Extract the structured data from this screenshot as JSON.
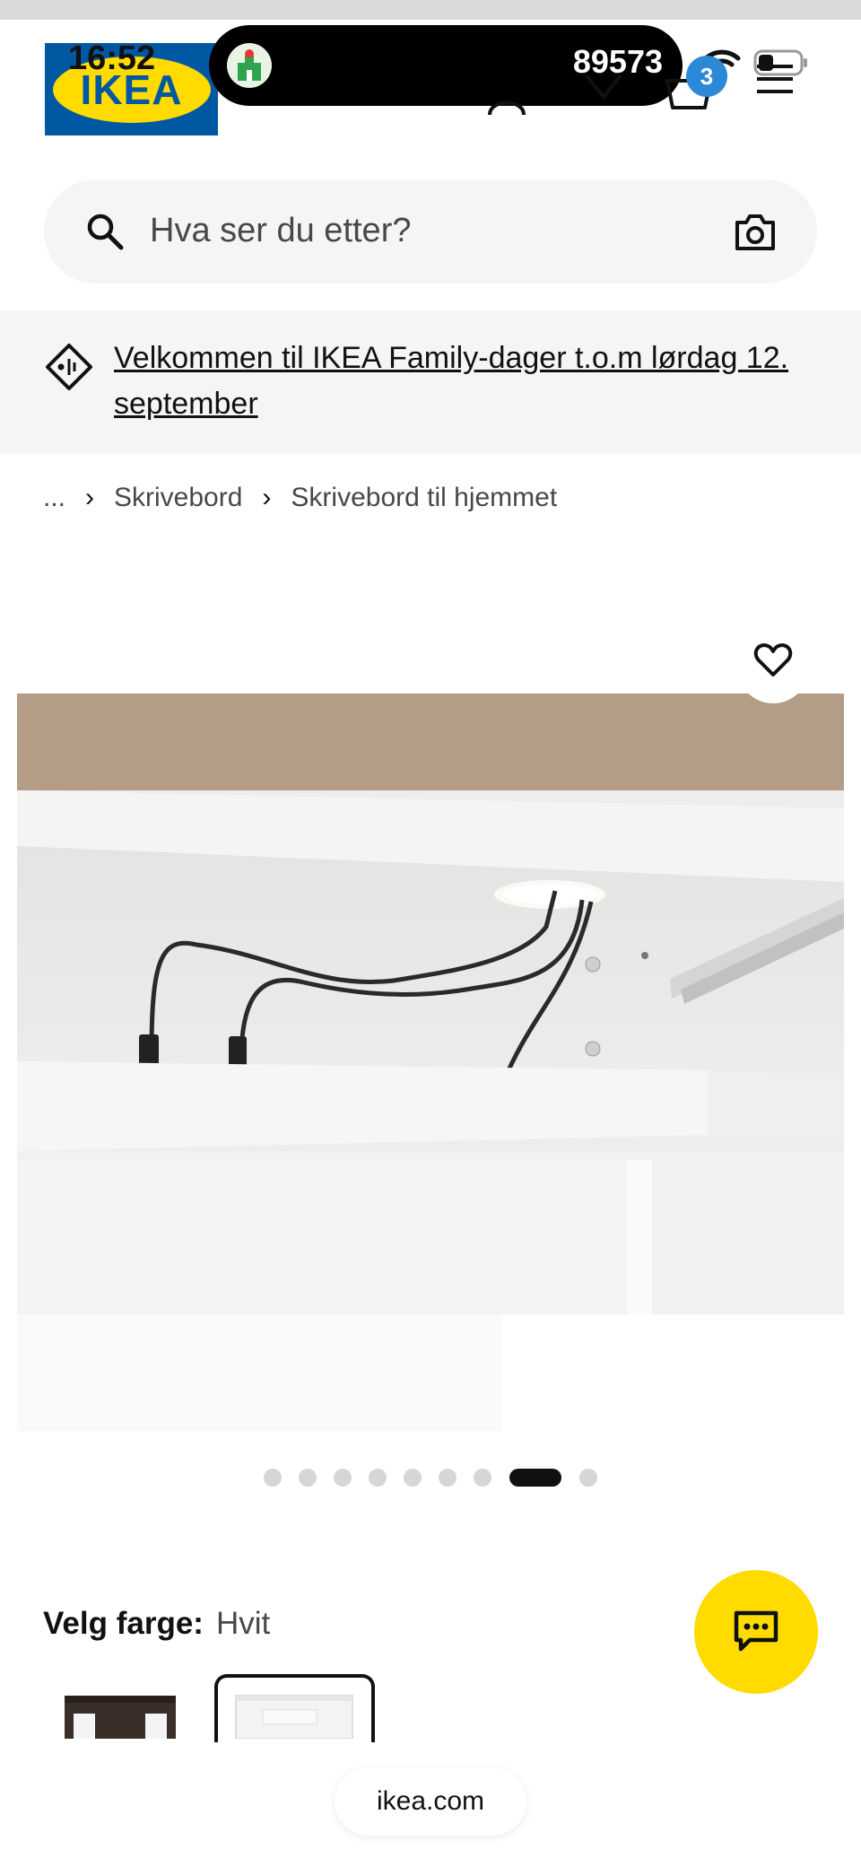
{
  "status_bar": {
    "time": "16:52",
    "island_number": "89573"
  },
  "header": {
    "logo_text": "IKEA",
    "cart_count": "3"
  },
  "search": {
    "placeholder": "Hva ser du etter?"
  },
  "promo": {
    "text": "Velkommen til IKEA Family-dager t.o.m lørdag 12. september"
  },
  "breadcrumb": {
    "items": [
      "...",
      "Skrivebord",
      "Skrivebord til hjemmet"
    ]
  },
  "carousel": {
    "total_images": 9,
    "active_index": 7
  },
  "color_picker": {
    "label": "Velg farge:",
    "selected_value": "Hvit",
    "options": [
      "dark-brown",
      "white"
    ]
  },
  "browser": {
    "url": "ikea.com"
  },
  "colors": {
    "ikea_blue": "#0058a3",
    "ikea_yellow": "#ffdb00",
    "badge_blue": "#2c89d8"
  }
}
